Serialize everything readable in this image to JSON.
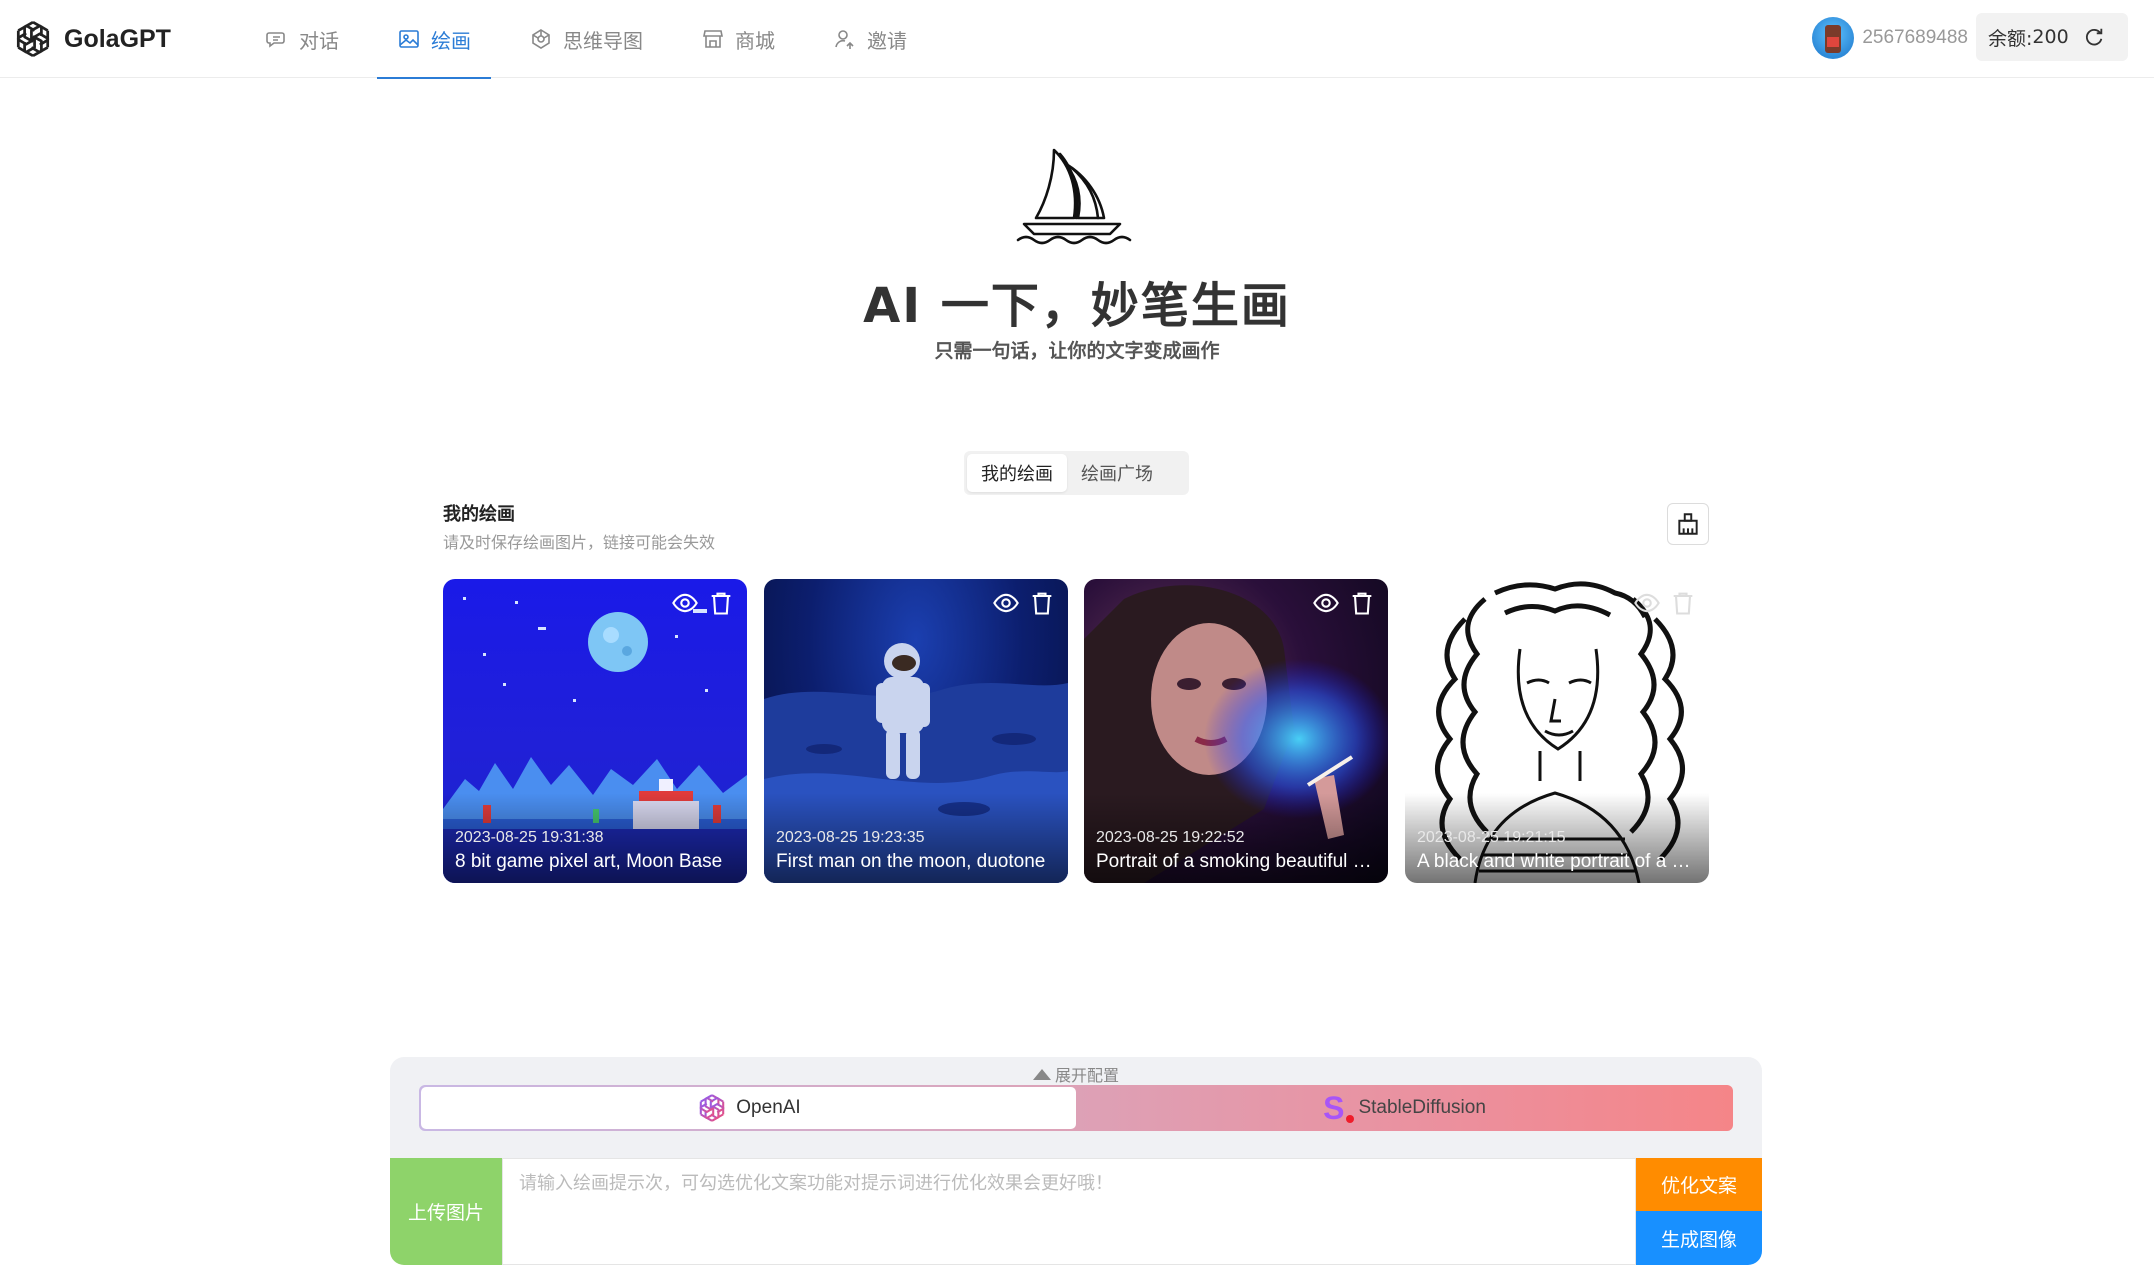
{
  "app": {
    "name": "GolaGPT"
  },
  "nav": {
    "items": [
      {
        "label": "对话",
        "icon": "chat-icon"
      },
      {
        "label": "绘画",
        "icon": "image-icon"
      },
      {
        "label": "思维导图",
        "icon": "mindmap-icon"
      },
      {
        "label": "商城",
        "icon": "store-icon"
      },
      {
        "label": "邀请",
        "icon": "invite-icon"
      }
    ],
    "active": "绘画"
  },
  "user": {
    "id": "2567689488",
    "balance_label": "余额: ",
    "balance_value": "200"
  },
  "hero": {
    "title": "AI 一下，妙笔生画",
    "subtitle": "只需一句话，让你的文字变成画作"
  },
  "tabs": {
    "items": [
      "我的绘画",
      "绘画广场"
    ],
    "active": "我的绘画"
  },
  "section": {
    "title": "我的绘画",
    "subtitle": "请及时保存绘画图片，链接可能会失效"
  },
  "cards": [
    {
      "date": "2023-08-25 19:31:38",
      "caption": "8 bit game pixel art, Moon Base"
    },
    {
      "date": "2023-08-25 19:23:35",
      "caption": "First man on the moon, duotone"
    },
    {
      "date": "2023-08-25 19:22:52",
      "caption": "Portrait of a smoking beautiful woman"
    },
    {
      "date": "2023-08-25 19:21:15",
      "caption": "A black and white portrait of a woman"
    }
  ],
  "panel": {
    "expand_label": "展开配置",
    "models": [
      "OpenAI",
      "StableDiffusion"
    ],
    "active_model": "OpenAI",
    "upload_label": "上传图片",
    "prompt_placeholder": "请输入绘画提示次，可勾选优化文案功能对提示词进行优化效果会更好哦！",
    "optimize_label": "优化文案",
    "generate_label": "生成图像"
  },
  "colors": {
    "accent": "#2b7cd6",
    "upload": "#8ed36a",
    "optimize": "#ff8c00",
    "generate": "#1890ff"
  }
}
